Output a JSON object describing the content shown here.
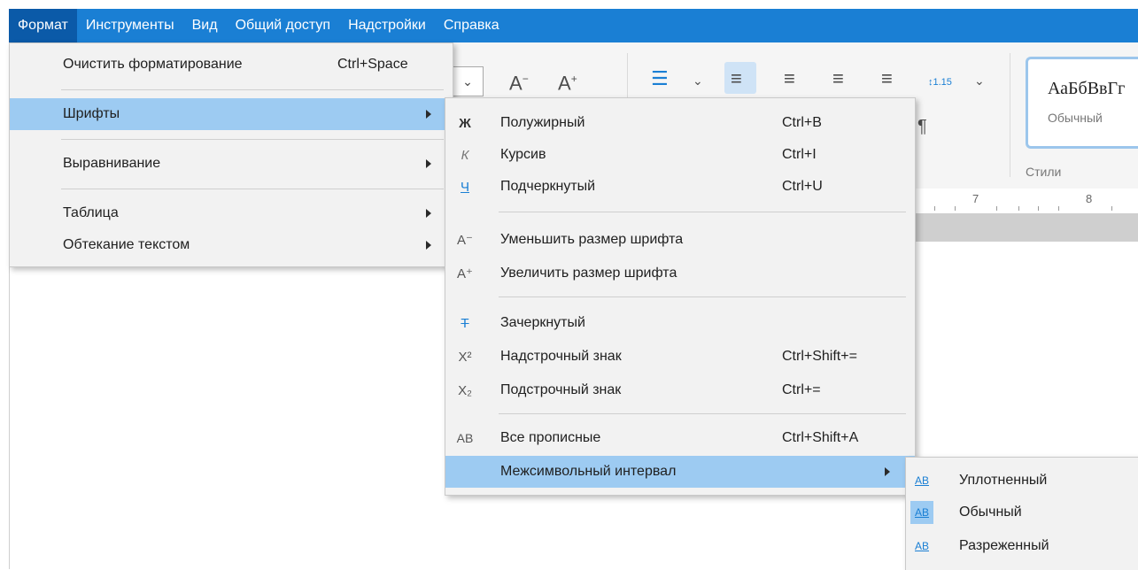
{
  "menubar": {
    "items": [
      "Формат",
      "Инструменты",
      "Вид",
      "Общий доступ",
      "Надстройки",
      "Справка"
    ]
  },
  "ribbon": {
    "style_sample": "АаБбВвГг",
    "style_name": "Обычный",
    "styles_group_label": "Стили",
    "line_spacing_value": "1.15",
    "ruler_numbers": [
      "7",
      "8"
    ]
  },
  "format_menu": {
    "items": [
      {
        "label": "Очистить форматирование",
        "shortcut": "Ctrl+Space"
      },
      {
        "label": "Шрифты",
        "submenu": true,
        "highlighted": true
      },
      {
        "label": "Выравнивание",
        "submenu": true
      },
      {
        "label": "Таблица",
        "submenu": true
      },
      {
        "label": "Обтекание текстом",
        "submenu": true
      }
    ]
  },
  "fonts_menu": {
    "items": [
      {
        "icon": "Ж",
        "icon_name": "bold-icon",
        "label": "Полужирный",
        "shortcut": "Ctrl+B"
      },
      {
        "icon": "К",
        "icon_name": "italic-icon",
        "label": "Курсив",
        "shortcut": "Ctrl+I"
      },
      {
        "icon": "Ч",
        "icon_name": "underline-icon",
        "label": "Подчеркнутый",
        "shortcut": "Ctrl+U"
      },
      {
        "icon": "A⁻",
        "icon_name": "decrease-font-size-icon",
        "label": "Уменьшить размер шрифта",
        "shortcut": ""
      },
      {
        "icon": "A⁺",
        "icon_name": "increase-font-size-icon",
        "label": "Увеличить размер шрифта",
        "shortcut": ""
      },
      {
        "icon": "T̶",
        "icon_name": "strikethrough-icon",
        "label": "Зачеркнутый",
        "shortcut": ""
      },
      {
        "icon": "X²",
        "icon_name": "superscript-icon",
        "label": "Надстрочный знак",
        "shortcut": "Ctrl+Shift+="
      },
      {
        "icon": "X₂",
        "icon_name": "subscript-icon",
        "label": "Подстрочный знак",
        "shortcut": "Ctrl+="
      },
      {
        "icon": "AB",
        "icon_name": "all-caps-icon",
        "label": "Все прописные",
        "shortcut": "Ctrl+Shift+A"
      },
      {
        "icon": "",
        "icon_name": "",
        "label": "Межсимвольный интервал",
        "shortcut": "",
        "submenu": true,
        "highlighted": true
      }
    ]
  },
  "spacing_menu": {
    "items": [
      {
        "icon": "AB",
        "icon_name": "condensed-spacing-icon",
        "label": "Уплотненный"
      },
      {
        "icon": "AB",
        "icon_name": "normal-spacing-icon",
        "label": "Обычный",
        "selected": true
      },
      {
        "icon": "AB",
        "icon_name": "expanded-spacing-icon",
        "label": "Разреженный"
      }
    ]
  },
  "colors": {
    "accent": "#1a7fd4",
    "menu_highlight": "#9dcbf2",
    "menu_bg": "#f2f2f2"
  }
}
